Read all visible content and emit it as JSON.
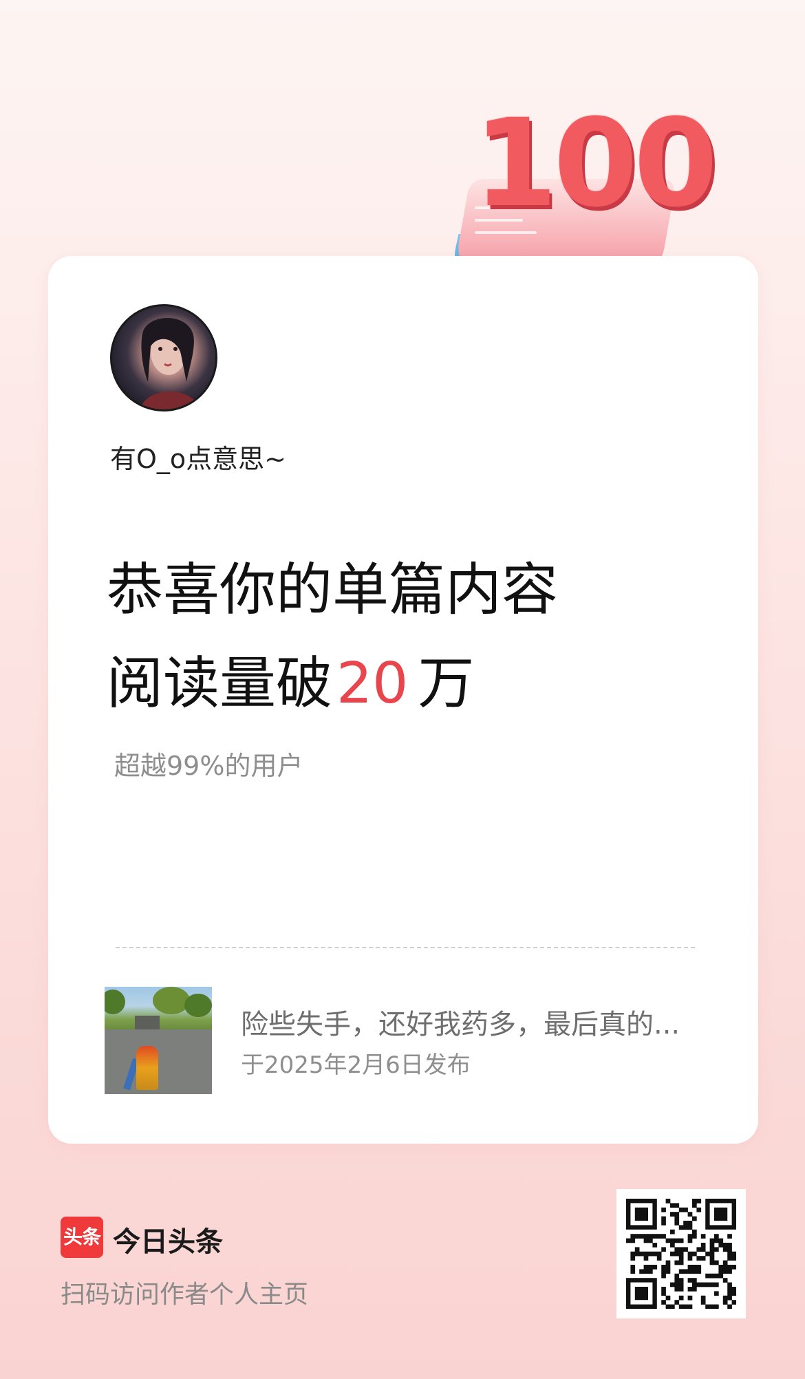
{
  "badge": {
    "number": "100"
  },
  "profile": {
    "username": "有O_o点意思~"
  },
  "headline": {
    "line1": "恭喜你的单篇内容",
    "line2_prefix": "阅读量破",
    "line2_number": "20",
    "line2_unit": "万"
  },
  "stats": {
    "subtext": "超越99%的用户"
  },
  "article": {
    "title": "险些失手，还好我药多，最后真的...",
    "date": "于2025年2月6日发布"
  },
  "footer": {
    "logo_text": "头条",
    "app_name": "今日头条",
    "hint": "扫码访问作者个人主页"
  },
  "colors": {
    "accent": "#e8454d",
    "logo_red": "#f0393a"
  },
  "icons": {
    "heart": "heart-icon",
    "qr": "qr-code-icon"
  }
}
